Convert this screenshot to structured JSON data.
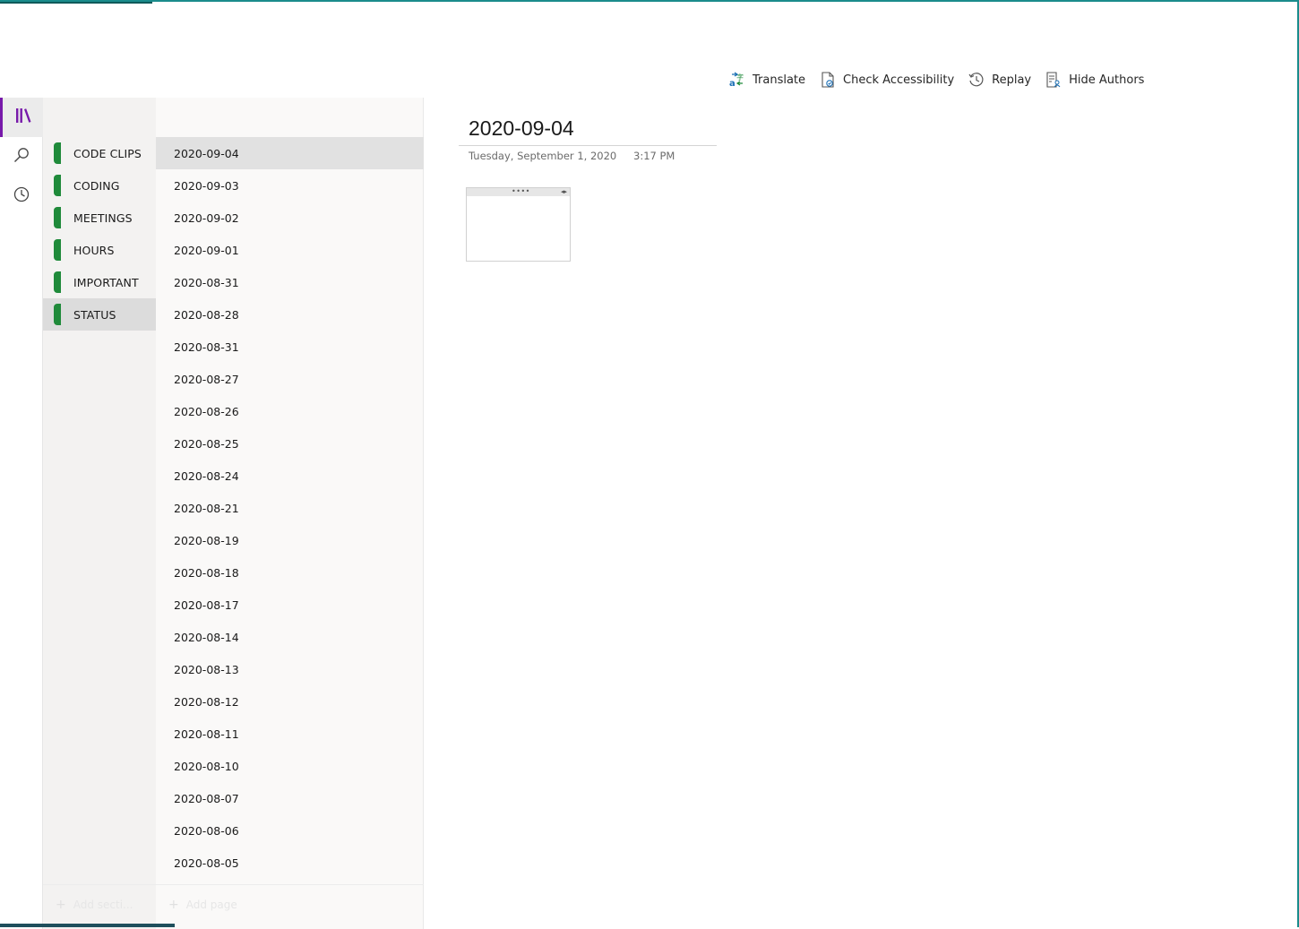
{
  "toolbar": {
    "translate": "Translate",
    "check_accessibility": "Check Accessibility",
    "replay": "Replay",
    "hide_authors": "Hide Authors"
  },
  "rail": {
    "icons": [
      "notebooks-icon",
      "search-icon",
      "recent-icon"
    ],
    "accent_color": "#7719aa"
  },
  "sections": {
    "items": [
      {
        "label": "CODE CLIPS"
      },
      {
        "label": "CODING"
      },
      {
        "label": "MEETINGS"
      },
      {
        "label": "HOURS"
      },
      {
        "label": "IMPORTANT"
      },
      {
        "label": "STATUS"
      }
    ],
    "active_index": 5,
    "tab_color": "#1f8a3a",
    "add_label": "Add secti..."
  },
  "pages": {
    "items": [
      "2020-09-04",
      "2020-09-03",
      "2020-09-02",
      "2020-09-01",
      "2020-08-31",
      "2020-08-28",
      "2020-08-31",
      "2020-08-27",
      "2020-08-26",
      "2020-08-25",
      "2020-08-24",
      "2020-08-21",
      "2020-08-19",
      "2020-08-18",
      "2020-08-17",
      "2020-08-14",
      "2020-08-13",
      "2020-08-12",
      "2020-08-11",
      "2020-08-10",
      "2020-08-07",
      "2020-08-06",
      "2020-08-05"
    ],
    "active_index": 0,
    "add_label": "Add page"
  },
  "page": {
    "title": "2020-09-04",
    "date": "Tuesday, September 1, 2020",
    "time": "3:17 PM",
    "note_handle_dots": "••••",
    "note_handle_arrows": "◂▸"
  }
}
